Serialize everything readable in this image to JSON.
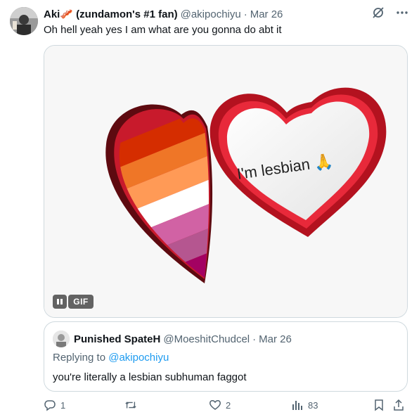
{
  "tweet": {
    "display_name": "Aki🥓 (zundamon's #1 fan)",
    "handle": "@akipochiyu",
    "separator": "·",
    "date": "Mar 26",
    "text": "Oh hell yeah yes I am what are you gonna do abt it"
  },
  "media": {
    "gif_label": "GIF",
    "heart_text": "I'm lesbian 🙏",
    "stripe_colors": [
      "#d52d00",
      "#ef7627",
      "#ff9a56",
      "#ffffff",
      "#d162a4",
      "#b55690",
      "#a30262"
    ]
  },
  "quote": {
    "display_name": "Punished SpateH",
    "handle": "@MoeshitChudcel",
    "separator": "·",
    "date": "Mar 26",
    "replying_prefix": "Replying to ",
    "replying_handle": "@akipochiyu",
    "text": "you're literally a lesbian subhuman faggot"
  },
  "actions": {
    "replies": "1",
    "likes": "2",
    "views": "83"
  },
  "colors": {
    "link": "#1d9bf0",
    "secondary_text": "#536471",
    "border": "#cfd9de"
  }
}
